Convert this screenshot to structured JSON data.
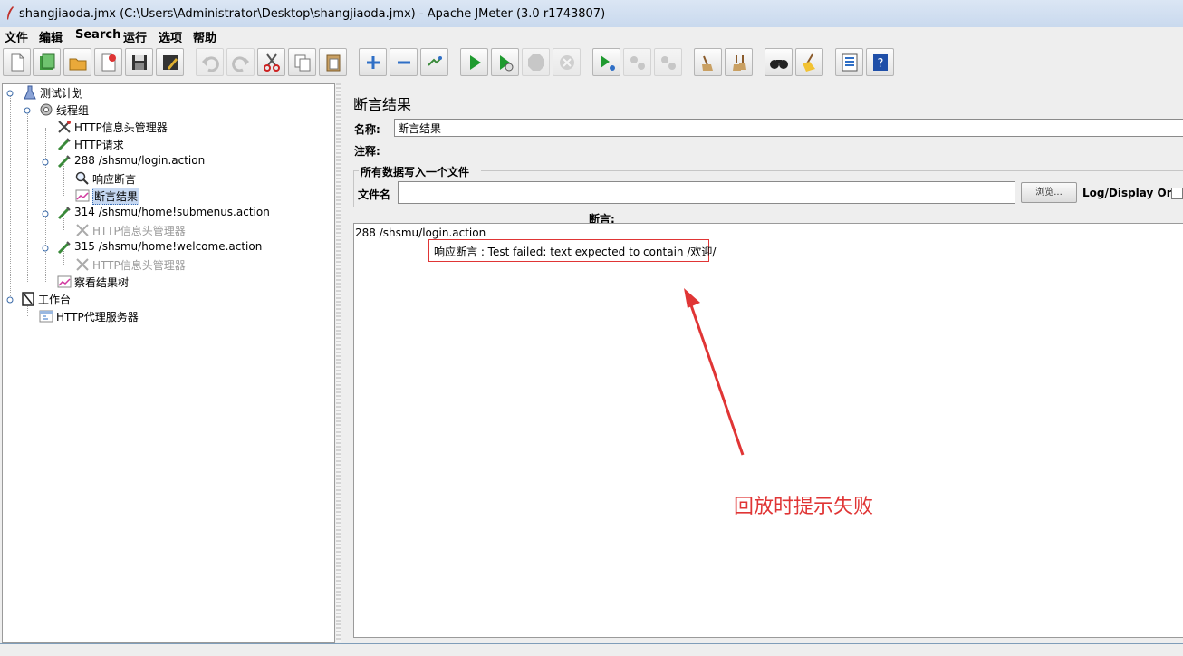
{
  "window": {
    "title": "shangjiaoda.jmx (C:\\Users\\Administrator\\Desktop\\shangjiaoda.jmx) - Apache JMeter (3.0 r1743807)"
  },
  "menu": [
    "文件",
    "编辑",
    "Search",
    "运行",
    "选项",
    "帮助"
  ],
  "toolbar": {
    "buttons": [
      "new-icon",
      "templates-icon",
      "open-icon",
      "close-icon",
      "save-icon",
      "save-as-icon",
      "undo-icon",
      "redo-icon",
      "cut-icon",
      "copy-icon",
      "paste-icon",
      "expand-icon",
      "collapse-icon",
      "toggle-icon",
      "start-icon",
      "start-no-pause-icon",
      "stop-icon",
      "shutdown-icon",
      "remote-start-icon",
      "remote-stop-icon",
      "remote-shutdown-icon",
      "clear-icon",
      "clear-all-icon",
      "search-icon",
      "reset-search-icon",
      "function-helper-icon",
      "help-icon"
    ]
  },
  "tree": {
    "nodes": [
      {
        "label": "测试计划",
        "icon": "test-plan-icon",
        "disabled": false
      },
      {
        "label": "线程组",
        "icon": "thread-group-icon",
        "disabled": false
      },
      {
        "label": "HTTP信息头管理器",
        "icon": "header-manager-icon",
        "disabled": false
      },
      {
        "label": "HTTP请求",
        "icon": "sampler-icon",
        "disabled": false
      },
      {
        "label": "288 /shsmu/login.action",
        "icon": "sampler-icon",
        "disabled": false
      },
      {
        "label": "响应断言",
        "icon": "assertion-icon",
        "disabled": false
      },
      {
        "label": "断言结果",
        "icon": "listener-icon",
        "disabled": false,
        "selected": true
      },
      {
        "label": "314 /shsmu/home!submenus.action",
        "icon": "sampler-icon",
        "disabled": false
      },
      {
        "label": "HTTP信息头管理器",
        "icon": "header-manager-icon",
        "disabled": true
      },
      {
        "label": "315 /shsmu/home!welcome.action",
        "icon": "sampler-icon",
        "disabled": false
      },
      {
        "label": "HTTP信息头管理器",
        "icon": "header-manager-icon",
        "disabled": true
      },
      {
        "label": "察看结果树",
        "icon": "listener-icon",
        "disabled": false
      },
      {
        "label": "工作台",
        "icon": "workbench-icon",
        "disabled": false
      },
      {
        "label": "HTTP代理服务器",
        "icon": "proxy-icon",
        "disabled": false
      }
    ]
  },
  "panel": {
    "title": "断言结果",
    "name_label": "名称:",
    "name_value": "断言结果",
    "comment_label": "注释:",
    "file_section_title": "所有数据写入一个文件",
    "file_label": "文件名",
    "file_value": "",
    "browse_label": "浏览...",
    "log_display_label": "Log/Display Only:",
    "assertion_label": "断言:",
    "assertion_sampler": "288 /shsmu/login.action",
    "assertion_message": "响应断言 : Test failed: text expected to contain /欢迎/"
  },
  "annotation": {
    "text": "回放时提示失败",
    "color": "#e03535"
  }
}
